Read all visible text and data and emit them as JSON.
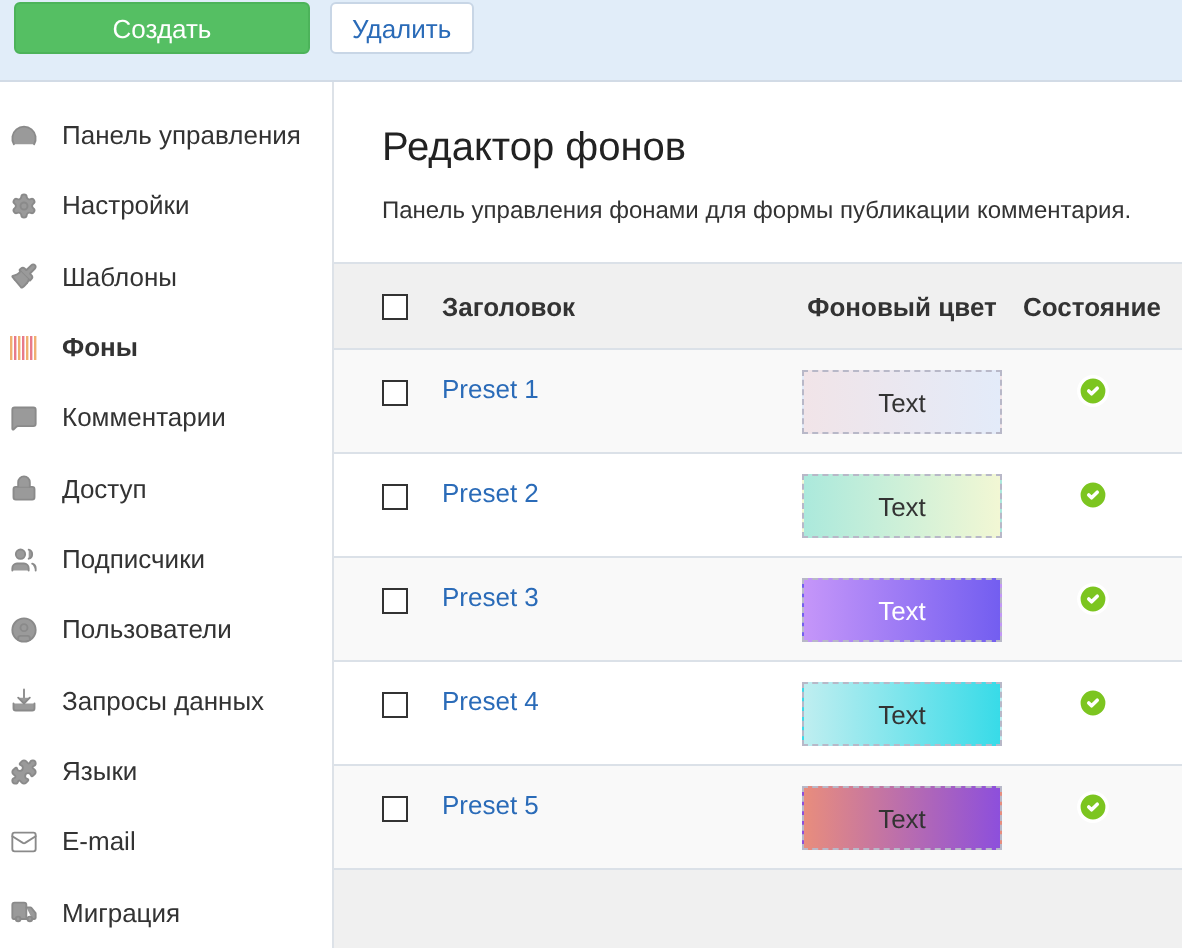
{
  "toolbar": {
    "buttons": [
      {
        "label": "Создать",
        "kind": "primary"
      },
      {
        "label": "Удалить",
        "kind": "secondary"
      }
    ]
  },
  "sidebar": {
    "items": [
      {
        "label": "Панель управления",
        "selected": false
      },
      {
        "label": "Настройки",
        "selected": false
      },
      {
        "label": "Шаблоны",
        "selected": false
      },
      {
        "label": "Фоны",
        "selected": true
      },
      {
        "label": "Комментарии",
        "selected": false
      },
      {
        "label": "Доступ",
        "selected": false
      },
      {
        "label": "Подписчики",
        "selected": false
      },
      {
        "label": "Пользователи",
        "selected": false
      },
      {
        "label": "Запросы данных",
        "selected": false
      },
      {
        "label": "Языки",
        "selected": false
      },
      {
        "label": "E-mail",
        "selected": false
      },
      {
        "label": "Миграция",
        "selected": false
      }
    ]
  },
  "main": {
    "title": "Редактор фонов",
    "description": "Панель управления фонами для формы публикации комментария."
  },
  "table": {
    "columns": [
      "Заголовок",
      "Фоновый цвет",
      "Состояние"
    ],
    "header_checked": false,
    "rows": [
      {
        "title": "Preset 1",
        "checked": false,
        "swatch": {
          "text": "Text",
          "stops": [
            {
              "color": "#f1e4e8"
            },
            {
              "color": "#e3ebf9"
            }
          ],
          "kind": "light"
        },
        "enabled": true
      },
      {
        "title": "Preset 2",
        "checked": false,
        "swatch": {
          "text": "Text",
          "stops": [
            {
              "color": "#abe9dc"
            },
            {
              "color": "#f2f7d4"
            }
          ],
          "kind": "light"
        },
        "enabled": true
      },
      {
        "title": "Preset 3",
        "checked": false,
        "swatch": {
          "text": "Text",
          "stops": [
            {
              "color": "#c596f9"
            },
            {
              "color": "#735ef0"
            }
          ],
          "kind": "dark"
        },
        "enabled": true
      },
      {
        "title": "Preset 4",
        "checked": false,
        "swatch": {
          "text": "Text",
          "stops": [
            {
              "color": "#bfeef0"
            },
            {
              "color": "#38dbe8"
            }
          ],
          "kind": "light"
        },
        "enabled": true
      },
      {
        "title": "Preset 5",
        "checked": false,
        "swatch": {
          "text": "Text",
          "stops": [
            {
              "color": "#e88d7d"
            },
            {
              "color": "#8d4fdc"
            }
          ],
          "kind": "light"
        },
        "enabled": true
      }
    ]
  }
}
